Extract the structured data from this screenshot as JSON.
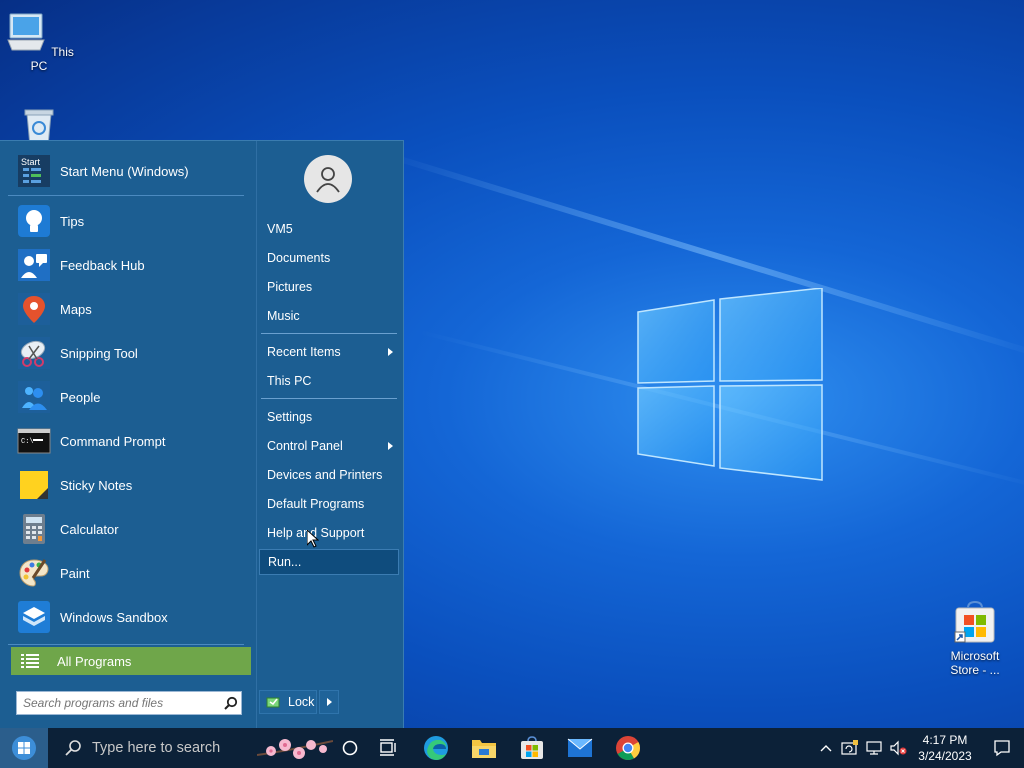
{
  "desktop": {
    "icons": [
      {
        "label": "This PC",
        "icon": "computer-icon"
      },
      {
        "label": "Recycle Bin",
        "icon": "recycle-bin-icon"
      },
      {
        "label": "Microsoft Store - ...",
        "icon": "store-icon"
      }
    ]
  },
  "start_menu": {
    "pinned": [
      {
        "label": "Start Menu (Windows)",
        "icon": "start-menu-icon"
      },
      {
        "label": "Tips",
        "icon": "lightbulb-icon"
      },
      {
        "label": "Feedback Hub",
        "icon": "feedback-icon"
      },
      {
        "label": "Maps",
        "icon": "map-pin-icon"
      },
      {
        "label": "Snipping Tool",
        "icon": "scissors-icon"
      },
      {
        "label": "People",
        "icon": "people-icon"
      },
      {
        "label": "Command Prompt",
        "icon": "terminal-icon"
      },
      {
        "label": "Sticky Notes",
        "icon": "sticky-note-icon"
      },
      {
        "label": "Calculator",
        "icon": "calculator-icon"
      },
      {
        "label": "Paint",
        "icon": "paint-palette-icon"
      },
      {
        "label": "Windows Sandbox",
        "icon": "sandbox-icon"
      }
    ],
    "all_programs": "All Programs",
    "search_placeholder": "Search programs and files",
    "right_items": [
      {
        "label": "VM5"
      },
      {
        "label": "Documents"
      },
      {
        "label": "Pictures"
      },
      {
        "label": "Music"
      },
      {
        "label": "Recent Items",
        "submenu": true
      },
      {
        "label": "This PC"
      },
      {
        "label": "Settings"
      },
      {
        "label": "Control Panel",
        "submenu": true
      },
      {
        "label": "Devices and Printers"
      },
      {
        "label": "Default Programs"
      },
      {
        "label": "Help and Support"
      },
      {
        "label": "Run...",
        "highlighted": true
      }
    ],
    "lock_label": "Lock"
  },
  "taskbar": {
    "search_placeholder": "Type here to search",
    "pinned_apps": [
      "cortana-icon",
      "task-view-icon",
      "edge-icon",
      "file-explorer-icon",
      "store-icon",
      "mail-icon",
      "chrome-icon"
    ],
    "clock_time": "4:17 PM",
    "clock_date": "3/24/2023"
  }
}
